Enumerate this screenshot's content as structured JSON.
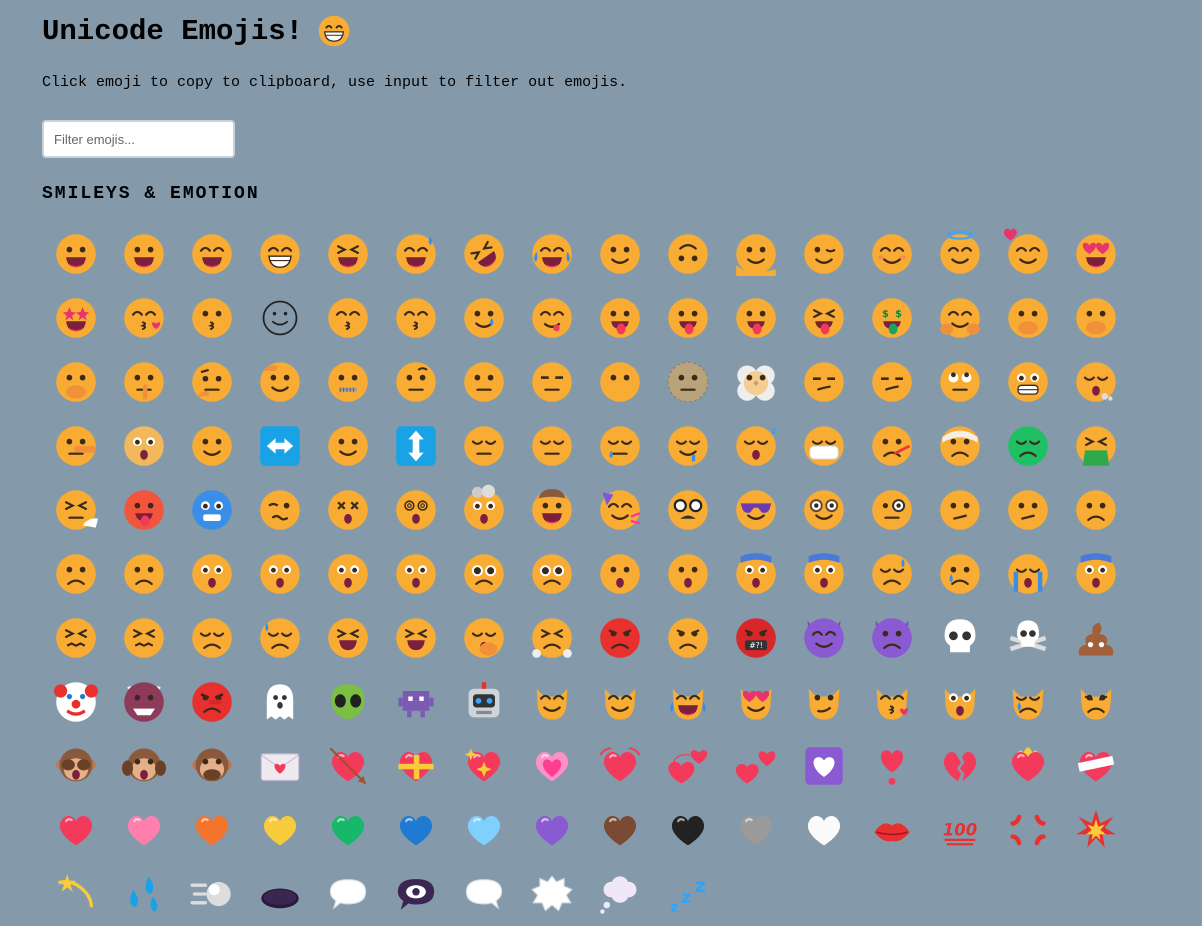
{
  "header": {
    "title": "Unicode Emojis!",
    "title_icon": "grinning-face-icon",
    "instructions": "Click emoji to copy to clipboard, use input to filter out emojis."
  },
  "filter": {
    "placeholder": "Filter emojis...",
    "value": ""
  },
  "section": {
    "heading": "SMILEYS & EMOTION"
  },
  "emojis": [
    "grinning-face",
    "grinning-face-big-eyes",
    "grinning-face-smiling-eyes",
    "beaming-face",
    "grinning-squinting-face",
    "grinning-face-sweat",
    "rolling-on-floor-laughing",
    "face-tears-of-joy",
    "slightly-smiling-face",
    "upside-down-face",
    "melting-face",
    "winking-face",
    "smiling-face-smiling-eyes",
    "smiling-face-halo",
    "smiling-face-hearts",
    "heart-eyes-face",
    "star-struck",
    "face-blowing-kiss",
    "kissing-face",
    "smiling-face-outline",
    "kissing-face-smiling-eyes",
    "kissing-face-closed-eyes",
    "smiling-face-tear",
    "face-savoring-food",
    "face-with-tongue",
    "winking-face-tongue",
    "zany-face",
    "squinting-face-tongue",
    "money-mouth-face",
    "hugging-face",
    "face-open-eyes-hand-over-mouth",
    "face-hand-over-mouth",
    "face-peeking-eye",
    "shushing-face",
    "thinking-face",
    "saluting-face",
    "zipper-mouth-face",
    "face-raised-eyebrow",
    "neutral-face",
    "expressionless-face",
    "face-without-mouth",
    "dotted-line-face",
    "face-in-clouds",
    "smirking-face",
    "unamused-face",
    "face-rolling-eyes",
    "grimacing-face",
    "face-exhaling",
    "lying-face",
    "shaking-face",
    "face-horizontal-arrow",
    "left-right-arrow-button",
    "face-vertical",
    "up-down-arrow-button",
    "relieved-face",
    "pensive-face",
    "sleepy-face",
    "drooling-face",
    "sleeping-face",
    "face-medical-mask",
    "face-thermometer",
    "face-head-bandage",
    "nauseated-face",
    "face-vomiting",
    "sneezing-face",
    "hot-face",
    "cold-face",
    "woozy-face",
    "face-crossed-out-eyes",
    "face-spiral-eyes",
    "exploding-head",
    "cowboy-hat-face",
    "partying-face",
    "disguised-face",
    "smiling-face-sunglasses",
    "nerd-face",
    "face-monocle",
    "confused-face",
    "face-diagonal-mouth",
    "worried-face",
    "slightly-frowning-face",
    "frowning-face",
    "face-open-mouth",
    "hushed-face",
    "astonished-face",
    "flushed-face",
    "pleading-face",
    "face-holding-back-tears",
    "frowning-face-open-mouth",
    "anguished-face",
    "fearful-face",
    "anxious-face-sweat",
    "sad-relieved-face",
    "crying-face",
    "loudly-crying-face",
    "face-screaming-in-fear",
    "confounded-face",
    "persevering-face",
    "disappointed-face",
    "downcast-face-sweat",
    "weary-face",
    "tired-face",
    "yawning-face",
    "face-steam-from-nose",
    "pouting-face",
    "angry-face",
    "face-symbols-on-mouth",
    "smiling-face-horns",
    "angry-face-horns",
    "skull",
    "skull-crossbones",
    "pile-of-poo",
    "clown-face",
    "ogre",
    "goblin",
    "ghost",
    "alien",
    "alien-monster",
    "robot",
    "grinning-cat",
    "grinning-cat-smiling-eyes",
    "cat-tears-of-joy",
    "smiling-cat-heart-eyes",
    "cat-wry-smile",
    "kissing-cat",
    "weary-cat",
    "crying-cat",
    "pouting-cat",
    "see-no-evil-monkey",
    "hear-no-evil-monkey",
    "speak-no-evil-monkey",
    "love-letter",
    "heart-with-arrow",
    "heart-with-ribbon",
    "sparkling-heart",
    "growing-heart",
    "beating-heart",
    "revolving-hearts",
    "two-hearts",
    "heart-decoration",
    "heart-exclamation",
    "broken-heart",
    "heart-on-fire",
    "mending-heart",
    "red-heart",
    "pink-heart",
    "orange-heart",
    "yellow-heart",
    "green-heart",
    "blue-heart",
    "light-blue-heart",
    "purple-heart",
    "brown-heart",
    "black-heart",
    "grey-heart",
    "white-heart",
    "kiss-mark",
    "hundred-points",
    "anger-symbol",
    "collision",
    "dizzy",
    "sweat-droplets",
    "dashing-away",
    "hole",
    "speech-balloon",
    "eye-in-speech-bubble",
    "left-speech-bubble",
    "right-anger-bubble",
    "thought-balloon",
    "zzz"
  ],
  "colors": {
    "background": "#849aab",
    "face": "#f8ac33",
    "red": "#f33a5a",
    "blue": "#1aa2e6"
  }
}
